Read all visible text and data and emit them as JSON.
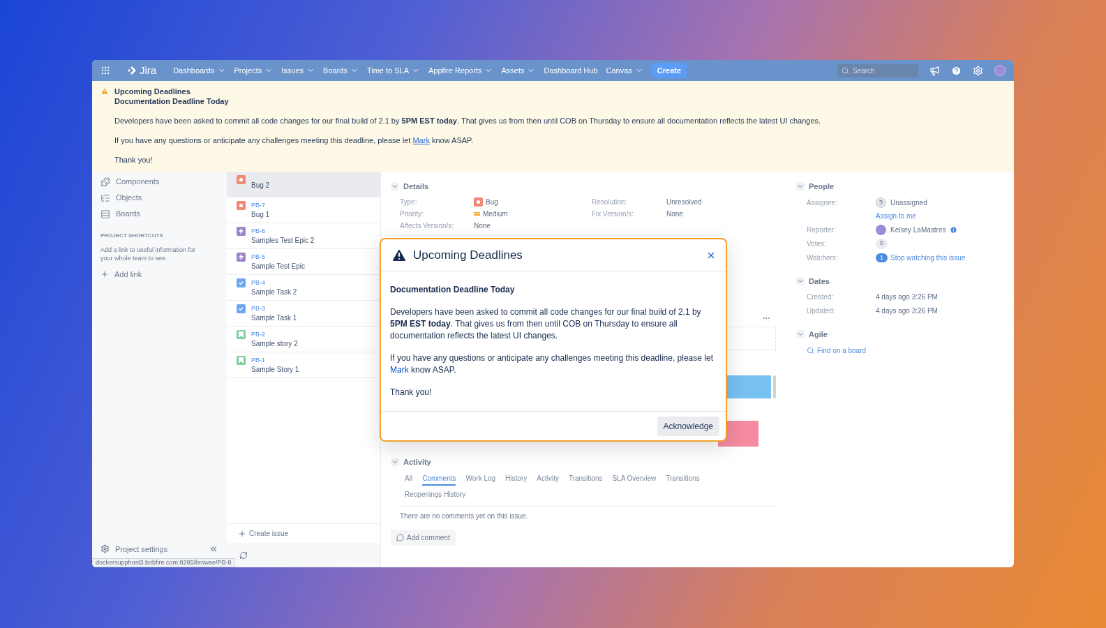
{
  "nav": {
    "logo": "Jira",
    "items": [
      {
        "label": "Dashboards",
        "dropdown": true
      },
      {
        "label": "Projects",
        "dropdown": true
      },
      {
        "label": "Issues",
        "dropdown": true
      },
      {
        "label": "Boards",
        "dropdown": true
      },
      {
        "label": "Time to SLA",
        "dropdown": true
      },
      {
        "label": "Appfire Reports",
        "dropdown": true
      },
      {
        "label": "Assets",
        "dropdown": true
      },
      {
        "label": "Dashboard Hub",
        "dropdown": false
      },
      {
        "label": "Canvas",
        "dropdown": true
      }
    ],
    "create": "Create",
    "search": {
      "placeholder": "Search"
    }
  },
  "banner": {
    "title": "Upcoming Deadlines",
    "subtitle": "Documentation Deadline Today",
    "paragraphs": [
      {
        "kind": "rich",
        "text": "Developers have been asked to commit all code changes for our final build of 2.1 by **5PM EST today**. That gives us from then until COB on Thursday to ensure all documentation reflects the latest UI changes."
      },
      {
        "kind": "link",
        "before": "If you have any questions or anticipate any challenges meeting this deadline, please let",
        "link": "Mark",
        "after": "know ASAP."
      },
      {
        "kind": "rich",
        "text": "Thank you!"
      }
    ]
  },
  "sidebar": {
    "items": [
      {
        "label": "Components"
      },
      {
        "label": "Objects"
      },
      {
        "label": "Boards"
      }
    ],
    "shortcuts_heading": "PROJECT SHORTCUTS",
    "shortcuts_text": "Add a link to useful information for your whole team to see.",
    "add_link": "Add link",
    "settings": "Project settings"
  },
  "issues": [
    {
      "title": "Bug 2",
      "kind": "bug",
      "selected": true
    },
    {
      "key": "PB-7",
      "title": "Bug 1",
      "kind": "bug",
      "selected": false
    },
    {
      "key": "PB-6",
      "title": "Samples Test Epic 2",
      "kind": "epic",
      "selected": false
    },
    {
      "key": "PB-5",
      "title": "Sample Test Epic",
      "kind": "epic",
      "selected": false
    },
    {
      "key": "PB-4",
      "title": "Sample Task 2",
      "kind": "task",
      "selected": false
    },
    {
      "key": "PB-3",
      "title": "Sample Task 1",
      "kind": "task",
      "selected": false
    },
    {
      "key": "PB-2",
      "title": "Sample story 2",
      "kind": "story",
      "selected": false
    },
    {
      "key": "PB-1",
      "title": "Sample Story 1",
      "kind": "story",
      "selected": false
    }
  ],
  "create_issue": "Create issue",
  "details": {
    "heading": "Details",
    "expanded": true,
    "left": [
      {
        "label": "Type:",
        "value": "Bug"
      },
      {
        "label": "Priority:",
        "value": "Medium"
      },
      {
        "label": "Affects Version/s:",
        "value": "None"
      }
    ],
    "right": [
      {
        "label": "Resolution:",
        "value": "Unresolved"
      },
      {
        "label": "Fix Version/s:",
        "value": "None"
      }
    ]
  },
  "activity": {
    "heading": "Activity",
    "expanded": true,
    "tabs": [
      {
        "label": "All",
        "selected": false
      },
      {
        "label": "Comments",
        "selected": true
      },
      {
        "label": "Work Log",
        "selected": false
      },
      {
        "label": "History",
        "selected": false
      },
      {
        "label": "Activity",
        "selected": false
      },
      {
        "label": "Transitions",
        "selected": false
      },
      {
        "label": "SLA Overview",
        "selected": false
      },
      {
        "label": "Transitions",
        "selected": false
      },
      {
        "label": "Reopenings History",
        "selected": false
      }
    ],
    "empty": "There are no comments yet on this issue.",
    "add_comment": "Add comment"
  },
  "people": {
    "heading": "People",
    "expanded": true,
    "rows": [
      {
        "label": "Assignee:",
        "kind": "unassigned",
        "value": "Unassigned",
        "link": "Assign to me"
      },
      {
        "label": "Reporter:",
        "kind": "user",
        "value": "Kelsey LaMastres"
      },
      {
        "label": "Votes:",
        "kind": "count",
        "value": "0"
      },
      {
        "label": "Watchers:",
        "kind": "watch",
        "count": "1",
        "value": "Stop watching this issue"
      }
    ]
  },
  "dates": {
    "heading": "Dates",
    "expanded": true,
    "rows": [
      {
        "label": "Created:",
        "value": "4 days ago 3:26 PM"
      },
      {
        "label": "Updated:",
        "value": "4 days ago 3:26 PM"
      }
    ]
  },
  "agile": {
    "heading": "Agile",
    "expanded": true,
    "link": "Find on a board"
  },
  "modal": {
    "title": "Upcoming Deadlines",
    "subtitle": "Documentation Deadline Today",
    "paragraphs": [
      {
        "kind": "rich",
        "text": "Developers have been asked to commit all code changes for our final build of 2.1 by **5PM EST today**. That gives us from then until COB on Thursday to ensure all documentation reflects the latest UI changes."
      },
      {
        "kind": "link",
        "before": "If you have any questions or anticipate any challenges meeting this deadline, please let",
        "link": "Mark",
        "after": "know ASAP."
      },
      {
        "kind": "rich",
        "text": "Thank you!"
      }
    ],
    "button": "Acknowledge"
  },
  "status_url": "dockersupphost3.bobfire.com:8285/browse/PB-8"
}
